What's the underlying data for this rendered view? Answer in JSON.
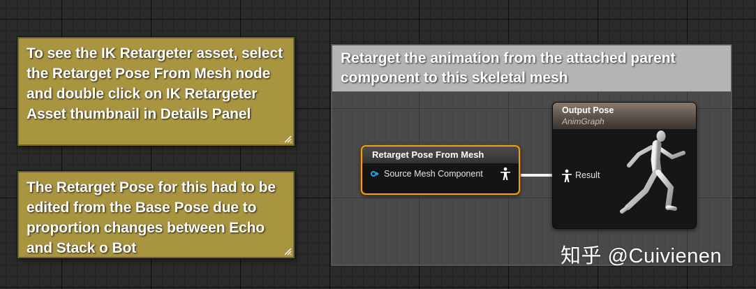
{
  "comments": {
    "ik_note": "To see the IK Retargeter asset, select the Retarget Pose From Mesh node and double click on IK Retargeter Asset thumbnail in Details Panel",
    "pose_note": "The Retarget Pose for this had to be edited from the Base Pose due to proportion changes between Echo and Stack o Bot",
    "region_title": "Retarget the animation from the attached parent component to this skeletal mesh"
  },
  "nodes": {
    "retarget": {
      "title": "Retarget Pose From Mesh",
      "input_pin": "Source Mesh Component"
    },
    "output": {
      "title": "Output Pose",
      "subtitle": "AnimGraph",
      "input_pin": "Result"
    }
  },
  "icons": {
    "pose_pin": "pose-person-icon",
    "object_pin": "object-pin-icon",
    "mannequin": "running-mannequin-icon",
    "resize": "resize-grip-icon"
  },
  "colors": {
    "comment_gold": "#a99440",
    "comment_header_grey": "#b4b4b4",
    "selected_node_border": "#f39f16",
    "object_pin_blue": "#1aa9e8",
    "output_header_brown": "#6f6358"
  },
  "watermark": "知乎 @Cuivienen"
}
